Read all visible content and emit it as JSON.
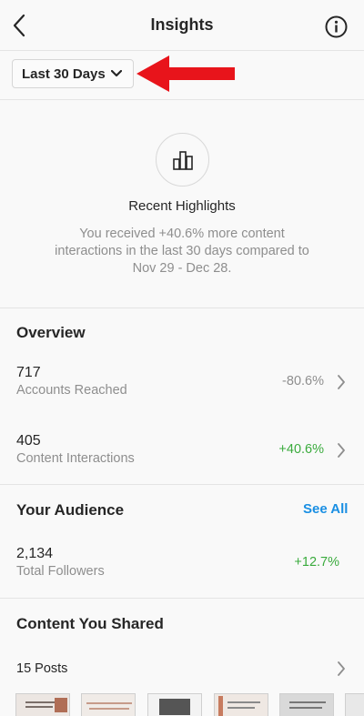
{
  "header": {
    "title": "Insights"
  },
  "filter": {
    "range_label": "Last 30 Days"
  },
  "highlights": {
    "title": "Recent Highlights",
    "line1": "You received +40.6% more content",
    "line2": "interactions in the last 30 days compared to",
    "line3": "Nov 29 - Dec 28."
  },
  "overview": {
    "title": "Overview",
    "metrics": [
      {
        "value": "717",
        "label": "Accounts Reached",
        "change": "-80.6%"
      },
      {
        "value": "405",
        "label": "Content Interactions",
        "change": "+40.6%"
      }
    ]
  },
  "audience": {
    "title": "Your Audience",
    "see_all": "See All",
    "followers": {
      "value": "2,134",
      "label": "Total Followers",
      "change": "+12.7%"
    }
  },
  "content": {
    "title": "Content You Shared",
    "posts_label": "15 Posts",
    "thumbnail_count": 6
  },
  "colors": {
    "positive": "#3aab3d",
    "negative": "#8e8e8e",
    "link": "#1a8fe3",
    "annotation_arrow": "#e8141b"
  }
}
